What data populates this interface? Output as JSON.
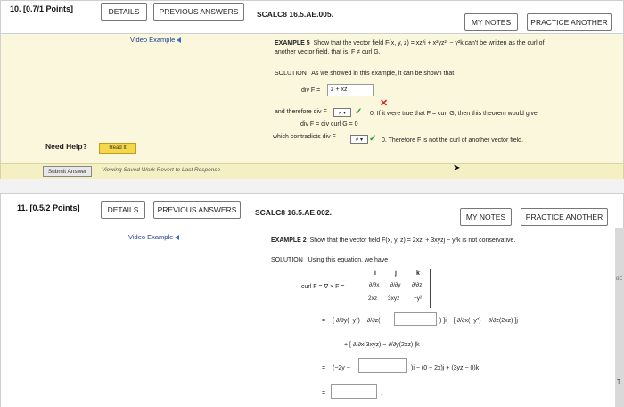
{
  "q10": {
    "number": "10. [0.7/1 Points]",
    "details": "DETAILS",
    "prev": "PREVIOUS ANSWERS",
    "id": "SCALC8 16.5.AE.005.",
    "notes": "MY NOTES",
    "practice": "PRACTICE ANOTHER",
    "video": "Video Example",
    "example_title": "EXAMPLE 5",
    "example_text": "Show that the vector field F(x, y, z) = xz²i + x²yz²j − y²k can't be written as the curl of",
    "example_text2": "another vector field, that is, F ≠ curl G.",
    "solution_label": "SOLUTION",
    "solution_text": "As we showed in this example, it can be shown that",
    "div_label": "div F =",
    "div_answer": "z + xz",
    "and_text": "and therefore div F",
    "sel1": "≠ ▾",
    "zero_text": "0. If it were true that F = curl G, then this theorem would give",
    "divcurl": "div F = div curl G = 0",
    "contra_text": "which contradicts div F",
    "sel2": "≠ ▾",
    "therefore_text": "0. Therefore F is not the curl of another vector field.",
    "need_help": "Need Help?",
    "read_it": "Read It",
    "submit": "Submit Answer",
    "viewing": "Viewing Saved Work Revert to Last Response"
  },
  "q11": {
    "number": "11. [0.5/2 Points]",
    "details": "DETAILS",
    "prev": "PREVIOUS ANSWERS",
    "id": "SCALC8 16.5.AE.002.",
    "notes": "MY NOTES",
    "practice": "PRACTICE ANOTHER",
    "video": "Video Example",
    "example_title": "EXAMPLE 2",
    "example_text": "Show that the vector field F(x, y, z) = 2xzi + 3xyzj − y²k is not conservative.",
    "solution_label": "SOLUTION",
    "solution_text": "Using this equation, we have",
    "curl_label": "curl F  =  ∇ × F =",
    "m_i": "i",
    "m_j": "j",
    "m_k": "k",
    "m_dx": "∂/∂x",
    "m_dy": "∂/∂y",
    "m_dz": "∂/∂z",
    "m_2xz": "2xz",
    "m_3xyz": "3xyz",
    "m_y2": "−y²",
    "eq": "=",
    "line1a": "[ ∂/∂y(−y²) − ∂/∂z(",
    "line1b": ") ]i − [ ∂/∂x(−y²) − ∂/∂z(2xz) ]j",
    "line2": "+ [ ∂/∂x(3xyz) − ∂/∂y(2xz) ]k",
    "line3a": "(−2y −",
    "line3b": ")i − (0 − 2x)j + (3yz − 0)k",
    "line4end": "."
  },
  "side": {
    "t1": "8E",
    "t2": "T"
  }
}
